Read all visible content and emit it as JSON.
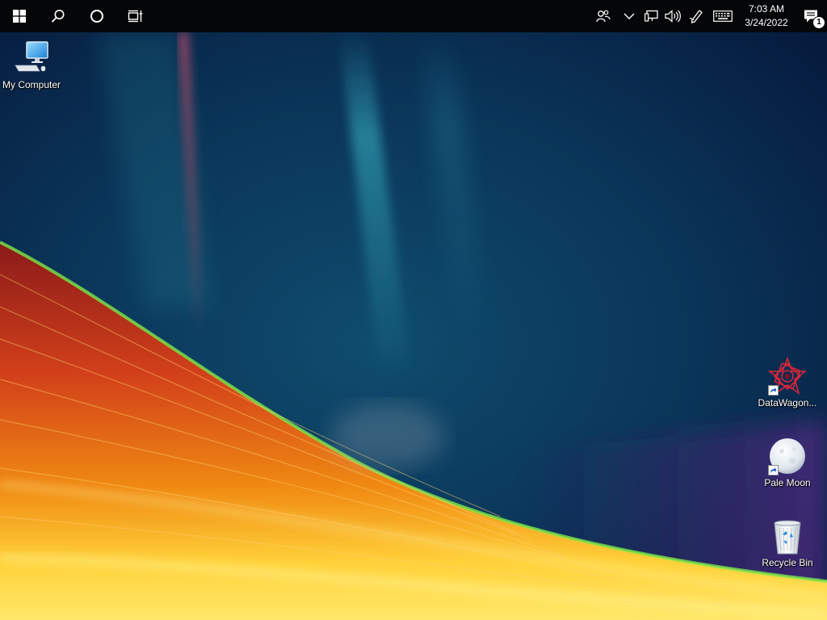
{
  "taskbar": {
    "start_icon": "windows-logo-icon",
    "search_icon": "search-icon",
    "cortana_icon": "cortana-circle-icon",
    "task_view_icon": "task-view-icon",
    "tray": {
      "people_icon": "people-icon",
      "overflow_icon": "chevron-up-icon",
      "network_icon": "network-icon",
      "volume_icon": "volume-icon",
      "pen_icon": "pen-workspace-icon",
      "keyboard_icon": "touch-keyboard-icon"
    },
    "clock": {
      "time": "7:03 AM",
      "date": "3/24/2022"
    },
    "notifications": {
      "icon": "action-center-icon",
      "count": "1"
    }
  },
  "desktop": {
    "icons": [
      {
        "label": "My Computer",
        "icon": "computer-icon"
      },
      {
        "label": "DataWagon...",
        "icon": "datawagon-star-icon"
      },
      {
        "label": "Pale Moon",
        "icon": "pale-moon-icon"
      },
      {
        "label": "Recycle Bin",
        "icon": "recycle-bin-icon"
      }
    ]
  },
  "colors": {
    "taskbar_bg": "#050608",
    "wallpaper_top": "#0b3a5c",
    "wallpaper_accent_orange": "#f08a12",
    "wallpaper_accent_red": "#b5241a",
    "wallpaper_accent_yellow": "#ffe23a"
  }
}
